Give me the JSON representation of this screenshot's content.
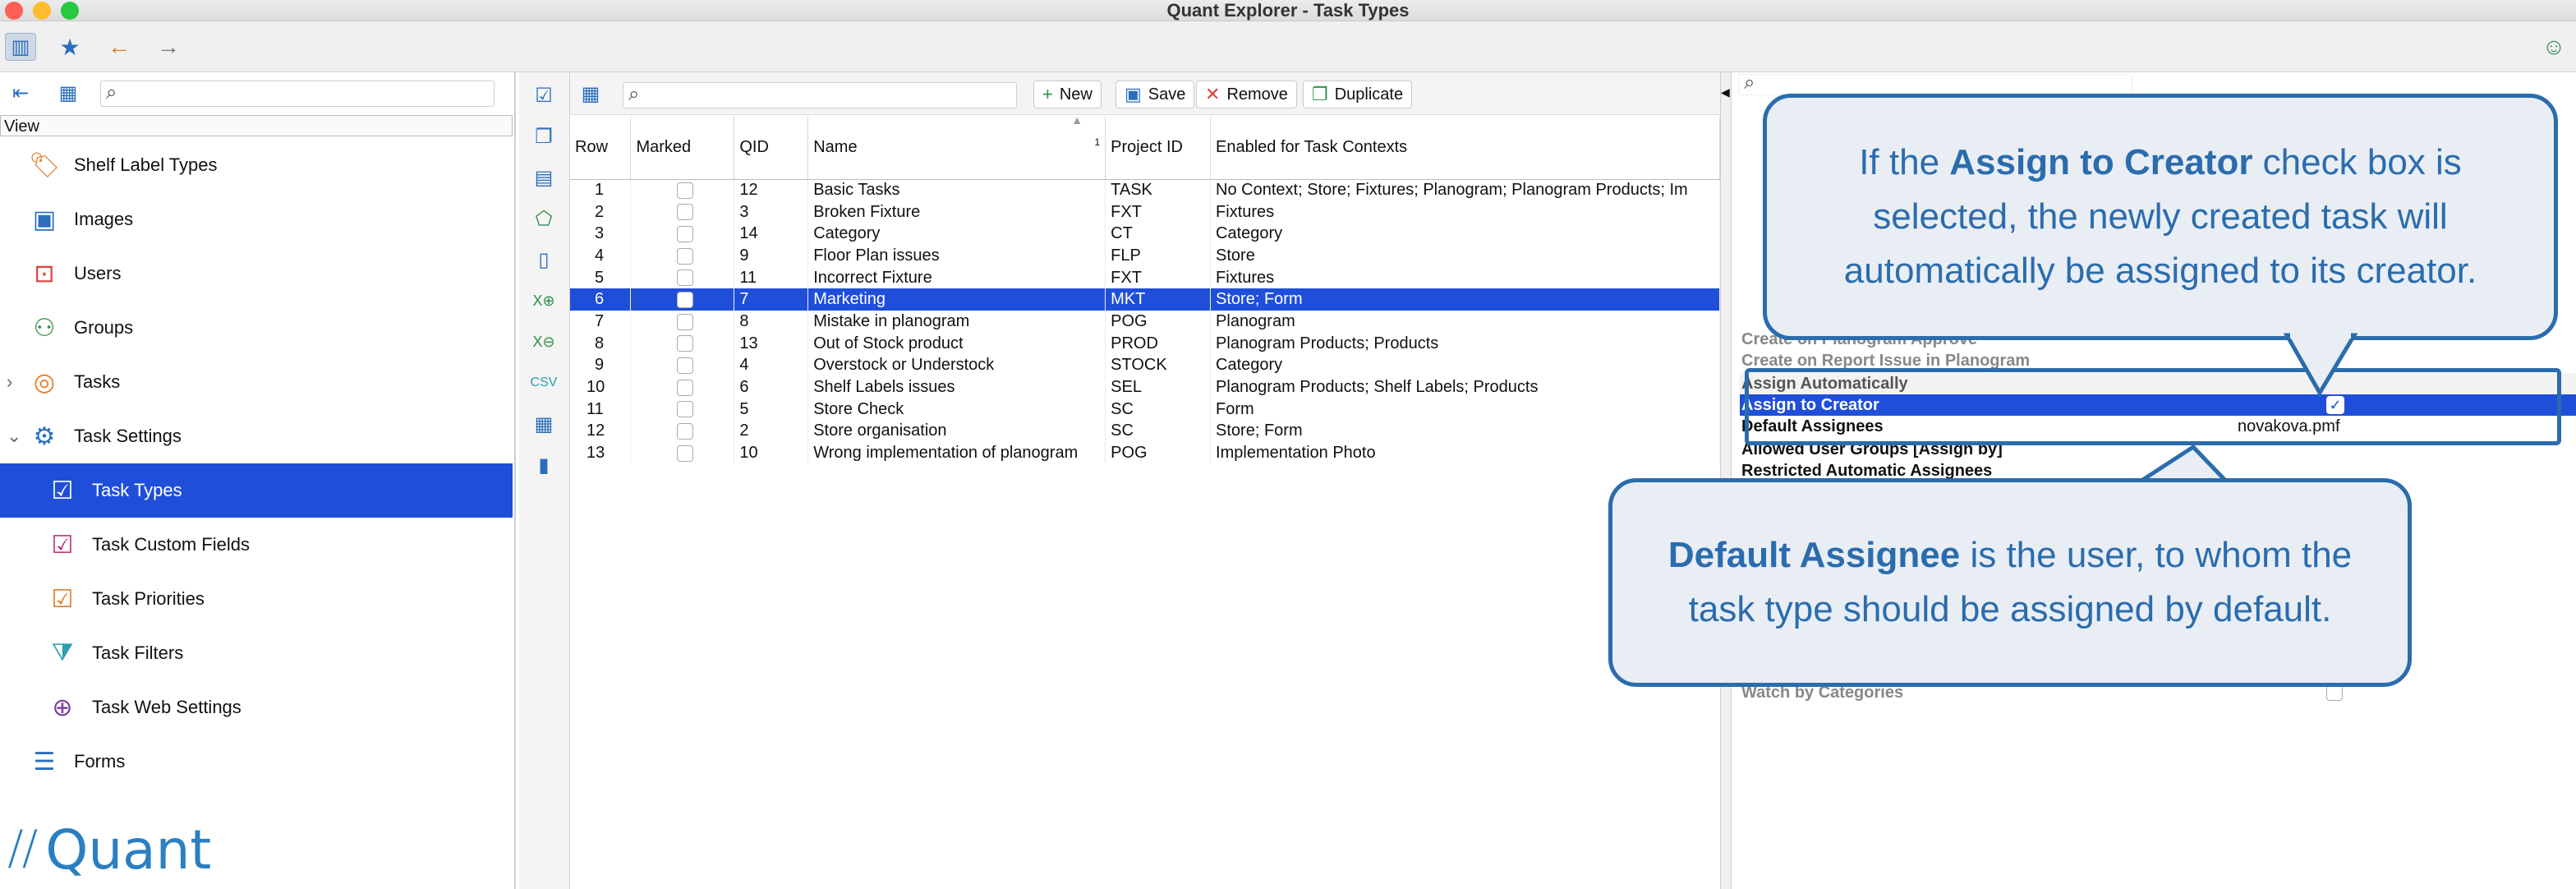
{
  "window": {
    "title": "Quant Explorer - Task Types"
  },
  "app_toolbar": {
    "icons": [
      "sidebar-toggle-icon",
      "star-icon",
      "back-arrow-icon",
      "forward-arrow-icon",
      "smiley-icon"
    ]
  },
  "left": {
    "view_label": "View",
    "items": [
      {
        "label": "Shelf Label Types",
        "icon": "shelf-label-icon",
        "color": "#e07b2a"
      },
      {
        "label": "Images",
        "icon": "image-icon",
        "color": "#2a6ebd"
      },
      {
        "label": "Users",
        "icon": "user-icon",
        "color": "#d9443c"
      },
      {
        "label": "Groups",
        "icon": "groups-icon",
        "color": "#2e8f4a"
      },
      {
        "label": "Tasks",
        "icon": "task-icon",
        "color": "#e07b2a"
      },
      {
        "label": "Task Settings",
        "icon": "task-settings-icon",
        "color": "#2a6ebd"
      },
      {
        "label": "Task Types",
        "icon": "task-types-icon",
        "color": "#2e8f4a"
      },
      {
        "label": "Task Custom Fields",
        "icon": "custom-fields-icon",
        "color": "#c0357a"
      },
      {
        "label": "Task Priorities",
        "icon": "priorities-icon",
        "color": "#e07b2a"
      },
      {
        "label": "Task Filters",
        "icon": "filters-icon",
        "color": "#2a9fb0"
      },
      {
        "label": "Task Web Settings",
        "icon": "web-settings-icon",
        "color": "#7a3fa0"
      },
      {
        "label": "Forms",
        "icon": "forms-icon",
        "color": "#2a6ebd"
      }
    ],
    "logo_text": "Quant"
  },
  "toolbar": {
    "new_label": "New",
    "save_label": "Save",
    "remove_label": "Remove",
    "duplicate_label": "Duplicate"
  },
  "table": {
    "headers": [
      "Row",
      "Marked",
      "QID",
      "Name",
      "Project ID",
      "Enabled for Task Contexts"
    ],
    "sort_indicator": "1",
    "rows": [
      {
        "row": "1",
        "qid": "12",
        "name": "Basic Tasks",
        "pid": "TASK",
        "ctx": "No Context; Store; Fixtures; Planogram; Planogram Products; Im"
      },
      {
        "row": "2",
        "qid": "3",
        "name": "Broken Fixture",
        "pid": "FXT",
        "ctx": "Fixtures"
      },
      {
        "row": "3",
        "qid": "14",
        "name": "Category",
        "pid": "CT",
        "ctx": "Category"
      },
      {
        "row": "4",
        "qid": "9",
        "name": "Floor Plan issues",
        "pid": "FLP",
        "ctx": "Store"
      },
      {
        "row": "5",
        "qid": "11",
        "name": "Incorrect Fixture",
        "pid": "FXT",
        "ctx": "Fixtures"
      },
      {
        "row": "6",
        "qid": "7",
        "name": "Marketing",
        "pid": "MKT",
        "ctx": "Store; Form"
      },
      {
        "row": "7",
        "qid": "8",
        "name": "Mistake in planogram",
        "pid": "POG",
        "ctx": "Planogram"
      },
      {
        "row": "8",
        "qid": "13",
        "name": "Out of Stock product",
        "pid": "PROD",
        "ctx": "Planogram Products; Products"
      },
      {
        "row": "9",
        "qid": "4",
        "name": "Overstock or Understock",
        "pid": "STOCK",
        "ctx": "Category"
      },
      {
        "row": "10",
        "qid": "6",
        "name": "Shelf Labels issues",
        "pid": "SEL",
        "ctx": "Planogram Products; Shelf Labels; Products"
      },
      {
        "row": "11",
        "qid": "5",
        "name": "Store Check",
        "pid": "SC",
        "ctx": "Form"
      },
      {
        "row": "12",
        "qid": "2",
        "name": "Store organisation",
        "pid": "SC",
        "ctx": "Store; Form"
      },
      {
        "row": "13",
        "qid": "10",
        "name": "Wrong implementation of planogram",
        "pid": "POG",
        "ctx": "Implementation Photo"
      }
    ]
  },
  "props": {
    "rows": [
      {
        "name": "Create on Planogram Approve",
        "style": "gray"
      },
      {
        "name": "Create on Report Issue in Planogram",
        "style": "gray"
      },
      {
        "name": "Assign Automatically",
        "style": "group"
      },
      {
        "name": "Assign to Creator",
        "style": "selected",
        "value": ""
      },
      {
        "name": "Default Assignees",
        "style": "bold",
        "value": "novakova.pmf"
      },
      {
        "name": "Allowed User Groups [Assign by]",
        "style": "bold"
      },
      {
        "name": "Restricted Automatic Assignees",
        "style": "bold"
      },
      {
        "name": "Watch by Categories",
        "style": "gray"
      }
    ]
  },
  "callouts": {
    "creator": {
      "pre": "If the ",
      "bold": "Assign to Creator",
      "post": " check box is selected, the newly created task will automatically be assigned to its creator."
    },
    "assignee": {
      "bold": "Default Assignee",
      "post": " is the user, to whom the task type should be assigned by default."
    }
  },
  "colors": {
    "selection": "#1f4fd9",
    "callout_border": "#2b6cad",
    "callout_fill": "#e9eef5"
  }
}
